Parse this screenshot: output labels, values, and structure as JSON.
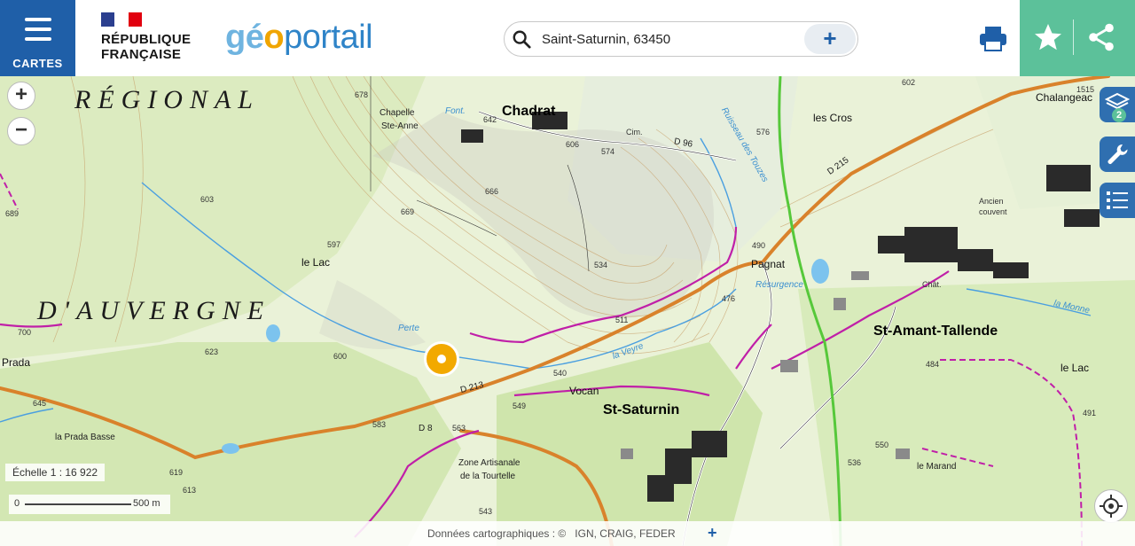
{
  "header": {
    "menu_label": "CARTES",
    "republic_line1": "RÉPUBLIQUE",
    "republic_line2": "FRANÇAISE",
    "logo_part1": "gé",
    "logo_part2": "o",
    "logo_part3": "portail",
    "search_value": "Saint-Saturnin, 63450",
    "search_add": "+"
  },
  "map": {
    "labels": {
      "region1": "RÉGIONAL",
      "region2": "D'AUVERGNE",
      "chadrat": "Chadrat",
      "chapelle": "Chapelle",
      "ste_anne": "Ste-Anne",
      "les_cros": "les Cros",
      "chalangeac": "Chalangeac",
      "le_lac": "le Lac",
      "pagnat": "Pagnat",
      "resurgence": "Résurgence",
      "st_amant": "St-Amant-Tallende",
      "st_saturnin": "St-Saturnin",
      "vocan": "Vocan",
      "la_prada_basse": "la Prada Basse",
      "prada": "Prada",
      "zone_artisanale": "Zone Artisanale",
      "de_la_tourtelle": "de la Tourtelle",
      "le_lac_east": "le Lac",
      "le_marand": "le Marand",
      "ancien_couvent": "Ancien",
      "couvent": "couvent",
      "perte": "Perte",
      "ruisseau_touzes": "Ruisseau des Touzes",
      "la_veyre": "la Veyre",
      "la_monne": "la Monne",
      "d213": "D 213",
      "d96": "D 96",
      "d215": "D 215",
      "d8": "D 8",
      "cim": "Cim.",
      "chat": "Chât.",
      "font": "Font.",
      "spot_678": "678",
      "spot_642": "642",
      "spot_606": "606",
      "spot_574": "574",
      "spot_576": "576",
      "spot_602": "602",
      "spot_666": "666",
      "spot_669": "669",
      "spot_603": "603",
      "spot_597": "597",
      "spot_623": "623",
      "spot_600": "600",
      "spot_700": "700",
      "spot_645": "645",
      "spot_583": "583",
      "spot_563": "563",
      "spot_549": "549",
      "spot_540": "540",
      "spot_511": "511",
      "spot_534": "534",
      "spot_490": "490",
      "spot_476": "476",
      "spot_484": "484",
      "spot_550": "550",
      "spot_536": "536",
      "spot_491": "491",
      "spot_619": "619",
      "spot_613": "613",
      "spot_543": "543",
      "spot_689": "689",
      "spot_1515": "1515"
    },
    "scale_text": "Échelle 1 : 16 922",
    "scale_zero": "0",
    "scale_end": "500 m",
    "layers_count": "2",
    "attribution_label": "Données cartographiques : ©",
    "attribution_sources": "IGN,  CRAIG,  FEDER",
    "attribution_more": "+"
  },
  "colors": {
    "menu_blue": "#1f5fa8",
    "share_green": "#5cc19a",
    "pin_orange": "#f2a900",
    "road_orange": "#d9822b",
    "path_magenta": "#c01fa8"
  },
  "icons": [
    "menu-icon",
    "search-icon",
    "plus-icon",
    "print-icon",
    "star-icon",
    "share-icon",
    "layers-icon",
    "wrench-icon",
    "legend-list-icon",
    "locate-icon",
    "zoom-in-icon",
    "zoom-out-icon"
  ]
}
